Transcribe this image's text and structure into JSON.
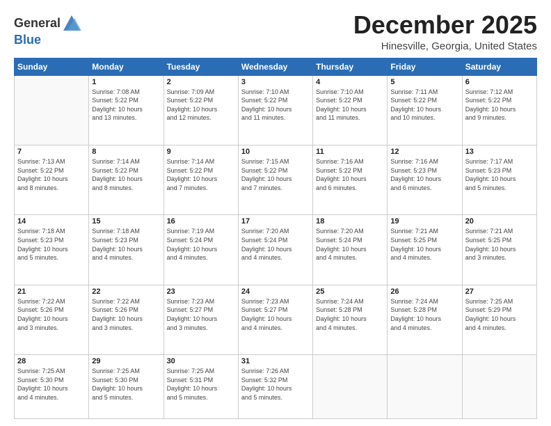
{
  "header": {
    "logo_general": "General",
    "logo_blue": "Blue",
    "month_title": "December 2025",
    "location": "Hinesville, Georgia, United States"
  },
  "days_of_week": [
    "Sunday",
    "Monday",
    "Tuesday",
    "Wednesday",
    "Thursday",
    "Friday",
    "Saturday"
  ],
  "weeks": [
    [
      {
        "day": "",
        "info": ""
      },
      {
        "day": "1",
        "info": "Sunrise: 7:08 AM\nSunset: 5:22 PM\nDaylight: 10 hours\nand 13 minutes."
      },
      {
        "day": "2",
        "info": "Sunrise: 7:09 AM\nSunset: 5:22 PM\nDaylight: 10 hours\nand 12 minutes."
      },
      {
        "day": "3",
        "info": "Sunrise: 7:10 AM\nSunset: 5:22 PM\nDaylight: 10 hours\nand 11 minutes."
      },
      {
        "day": "4",
        "info": "Sunrise: 7:10 AM\nSunset: 5:22 PM\nDaylight: 10 hours\nand 11 minutes."
      },
      {
        "day": "5",
        "info": "Sunrise: 7:11 AM\nSunset: 5:22 PM\nDaylight: 10 hours\nand 10 minutes."
      },
      {
        "day": "6",
        "info": "Sunrise: 7:12 AM\nSunset: 5:22 PM\nDaylight: 10 hours\nand 9 minutes."
      }
    ],
    [
      {
        "day": "7",
        "info": "Sunrise: 7:13 AM\nSunset: 5:22 PM\nDaylight: 10 hours\nand 8 minutes."
      },
      {
        "day": "8",
        "info": "Sunrise: 7:14 AM\nSunset: 5:22 PM\nDaylight: 10 hours\nand 8 minutes."
      },
      {
        "day": "9",
        "info": "Sunrise: 7:14 AM\nSunset: 5:22 PM\nDaylight: 10 hours\nand 7 minutes."
      },
      {
        "day": "10",
        "info": "Sunrise: 7:15 AM\nSunset: 5:22 PM\nDaylight: 10 hours\nand 7 minutes."
      },
      {
        "day": "11",
        "info": "Sunrise: 7:16 AM\nSunset: 5:22 PM\nDaylight: 10 hours\nand 6 minutes."
      },
      {
        "day": "12",
        "info": "Sunrise: 7:16 AM\nSunset: 5:23 PM\nDaylight: 10 hours\nand 6 minutes."
      },
      {
        "day": "13",
        "info": "Sunrise: 7:17 AM\nSunset: 5:23 PM\nDaylight: 10 hours\nand 5 minutes."
      }
    ],
    [
      {
        "day": "14",
        "info": "Sunrise: 7:18 AM\nSunset: 5:23 PM\nDaylight: 10 hours\nand 5 minutes."
      },
      {
        "day": "15",
        "info": "Sunrise: 7:18 AM\nSunset: 5:23 PM\nDaylight: 10 hours\nand 4 minutes."
      },
      {
        "day": "16",
        "info": "Sunrise: 7:19 AM\nSunset: 5:24 PM\nDaylight: 10 hours\nand 4 minutes."
      },
      {
        "day": "17",
        "info": "Sunrise: 7:20 AM\nSunset: 5:24 PM\nDaylight: 10 hours\nand 4 minutes."
      },
      {
        "day": "18",
        "info": "Sunrise: 7:20 AM\nSunset: 5:24 PM\nDaylight: 10 hours\nand 4 minutes."
      },
      {
        "day": "19",
        "info": "Sunrise: 7:21 AM\nSunset: 5:25 PM\nDaylight: 10 hours\nand 4 minutes."
      },
      {
        "day": "20",
        "info": "Sunrise: 7:21 AM\nSunset: 5:25 PM\nDaylight: 10 hours\nand 3 minutes."
      }
    ],
    [
      {
        "day": "21",
        "info": "Sunrise: 7:22 AM\nSunset: 5:26 PM\nDaylight: 10 hours\nand 3 minutes."
      },
      {
        "day": "22",
        "info": "Sunrise: 7:22 AM\nSunset: 5:26 PM\nDaylight: 10 hours\nand 3 minutes."
      },
      {
        "day": "23",
        "info": "Sunrise: 7:23 AM\nSunset: 5:27 PM\nDaylight: 10 hours\nand 3 minutes."
      },
      {
        "day": "24",
        "info": "Sunrise: 7:23 AM\nSunset: 5:27 PM\nDaylight: 10 hours\nand 4 minutes."
      },
      {
        "day": "25",
        "info": "Sunrise: 7:24 AM\nSunset: 5:28 PM\nDaylight: 10 hours\nand 4 minutes."
      },
      {
        "day": "26",
        "info": "Sunrise: 7:24 AM\nSunset: 5:28 PM\nDaylight: 10 hours\nand 4 minutes."
      },
      {
        "day": "27",
        "info": "Sunrise: 7:25 AM\nSunset: 5:29 PM\nDaylight: 10 hours\nand 4 minutes."
      }
    ],
    [
      {
        "day": "28",
        "info": "Sunrise: 7:25 AM\nSunset: 5:30 PM\nDaylight: 10 hours\nand 4 minutes."
      },
      {
        "day": "29",
        "info": "Sunrise: 7:25 AM\nSunset: 5:30 PM\nDaylight: 10 hours\nand 5 minutes."
      },
      {
        "day": "30",
        "info": "Sunrise: 7:25 AM\nSunset: 5:31 PM\nDaylight: 10 hours\nand 5 minutes."
      },
      {
        "day": "31",
        "info": "Sunrise: 7:26 AM\nSunset: 5:32 PM\nDaylight: 10 hours\nand 5 minutes."
      },
      {
        "day": "",
        "info": ""
      },
      {
        "day": "",
        "info": ""
      },
      {
        "day": "",
        "info": ""
      }
    ]
  ]
}
